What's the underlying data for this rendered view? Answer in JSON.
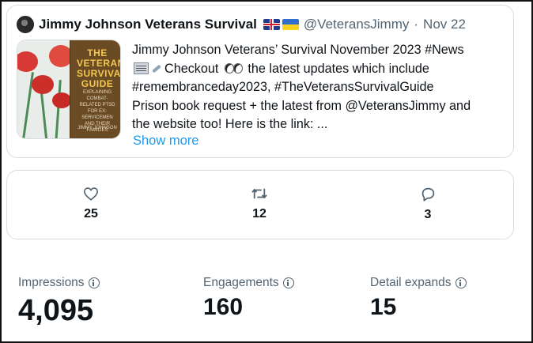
{
  "tweet": {
    "author": "Jimmy Johnson Veterans Survival",
    "handle": "@VeteransJimmy",
    "separator": "·",
    "date": "Nov 22",
    "text_lines": [
      "Jimmy Johnson Veterans’ Survival November 2023 #News",
      "Checkout",
      "the latest updates which include",
      "#remembranceday2023, #TheVeteransSurvivalGuide",
      "Prison book request + the latest from @VeteransJimmy and",
      "the website too! Here is the link: ..."
    ],
    "show_more": "Show more",
    "thumbnail": {
      "book_title": "THE VETERANS SURVIVAL GUIDE",
      "book_subtitle": "EXPLAINING COMBAT-RELATED PTSD FOR EX-SERVICEMEN AND THEIR FAMILIES",
      "book_author": "JIMMY JOHNSON"
    },
    "icons": {
      "flags": [
        "uk-flag-icon",
        "ukraine-flag-icon"
      ],
      "emoji": [
        "newspaper-icon",
        "satellite-icon",
        "eyes-icon"
      ]
    }
  },
  "actions": {
    "likes": "25",
    "retweets": "12",
    "replies": "3",
    "icons": [
      "heart-icon",
      "retweet-icon",
      "reply-icon"
    ]
  },
  "metrics": {
    "impressions_label": "Impressions",
    "impressions_value": "4,095",
    "engagements_label": "Engagements",
    "engagements_value": "160",
    "detail_expands_label": "Detail expands",
    "detail_expands_value": "15"
  },
  "colors": {
    "text": "#0f1419",
    "muted": "#536471",
    "link": "#1d9bf0",
    "border": "#d9dde1"
  }
}
